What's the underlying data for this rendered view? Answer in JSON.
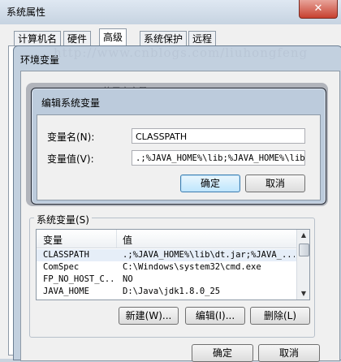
{
  "system_properties": {
    "title": "系统属性",
    "close_glyph": "✕",
    "tabs": [
      "计算机名",
      "硬件",
      "高级",
      "系统保护",
      "远程"
    ],
    "ok_label": "确定",
    "cancel_label": "取消"
  },
  "env_window": {
    "title": "环境变量",
    "user_vars_label": "Administrator 的用户变量(U)",
    "watermark": "http://www.cnblogs.com/liuhongfeng"
  },
  "system_vars": {
    "label": "系统变量(S)",
    "columns": [
      "变量",
      "值"
    ],
    "rows": [
      {
        "name": "CLASSPATH",
        "value": ".;%JAVA_HOME%\\lib\\dt.jar;%JAVA_..."
      },
      {
        "name": "ComSpec",
        "value": "C:\\Windows\\system32\\cmd.exe"
      },
      {
        "name": "FP_NO_HOST_C...",
        "value": "NO"
      },
      {
        "name": "JAVA_HOME",
        "value": "D:\\Java\\jdk1.8.0_25"
      }
    ],
    "buttons": {
      "new": "新建(W)...",
      "edit": "编辑(I)...",
      "delete": "删除(L)"
    }
  },
  "edit_dialog": {
    "title": "编辑系统变量",
    "name_label": "变量名(N):",
    "value_label": "变量值(V):",
    "name_value": "CLASSPATH",
    "value_value": ".;%JAVA_HOME%\\lib;%JAVA_HOME%\\lib\\d",
    "ok_label": "确定",
    "cancel_label": "取消"
  },
  "icons": {
    "scroll_up": "▲",
    "scroll_down": "▼"
  },
  "colors": {
    "title_bar": "#c6d3e1",
    "close_button": "#c7402f",
    "default_button_border": "#3c7fb1"
  }
}
